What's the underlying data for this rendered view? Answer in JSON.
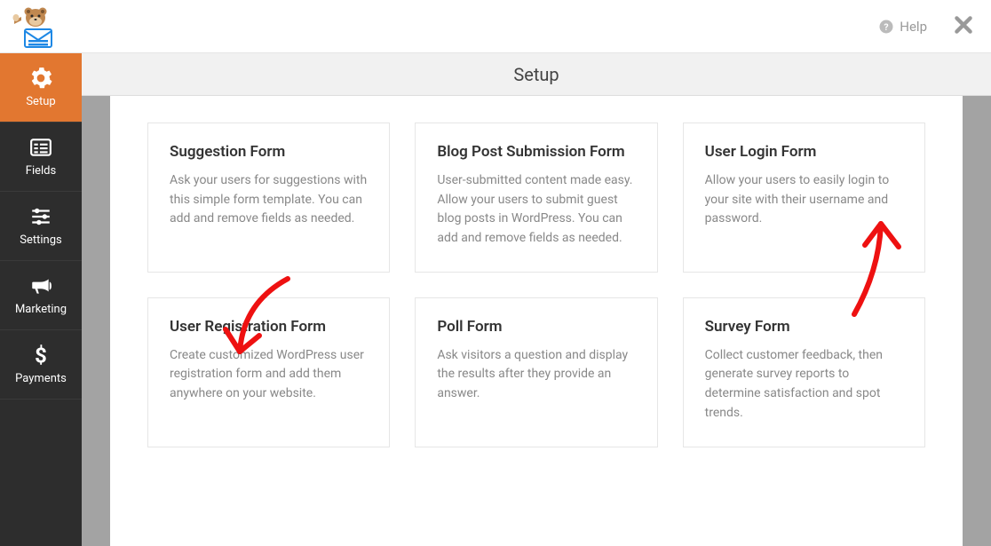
{
  "header": {
    "help_label": "Help"
  },
  "sidebar": {
    "items": [
      {
        "label": "Setup",
        "icon": "gear"
      },
      {
        "label": "Fields",
        "icon": "list"
      },
      {
        "label": "Settings",
        "icon": "sliders"
      },
      {
        "label": "Marketing",
        "icon": "bullhorn"
      },
      {
        "label": "Payments",
        "icon": "dollar"
      }
    ]
  },
  "page": {
    "title": "Setup"
  },
  "templates": [
    {
      "title": "Suggestion Form",
      "desc": "Ask your users for suggestions with this simple form template. You can add and remove fields as needed."
    },
    {
      "title": "Blog Post Submission Form",
      "desc": "User-submitted content made easy. Allow your users to submit guest blog posts in WordPress. You can add and remove fields as needed."
    },
    {
      "title": "User Login Form",
      "desc": "Allow your users to easily login to your site with their username and password."
    },
    {
      "title": "User Registration Form",
      "desc": "Create customized WordPress user registration form and add them anywhere on your website."
    },
    {
      "title": "Poll Form",
      "desc": "Ask visitors a question and display the results after they provide an answer."
    },
    {
      "title": "Survey Form",
      "desc": "Collect customer feedback, then generate survey reports to determine satisfaction and spot trends."
    }
  ]
}
